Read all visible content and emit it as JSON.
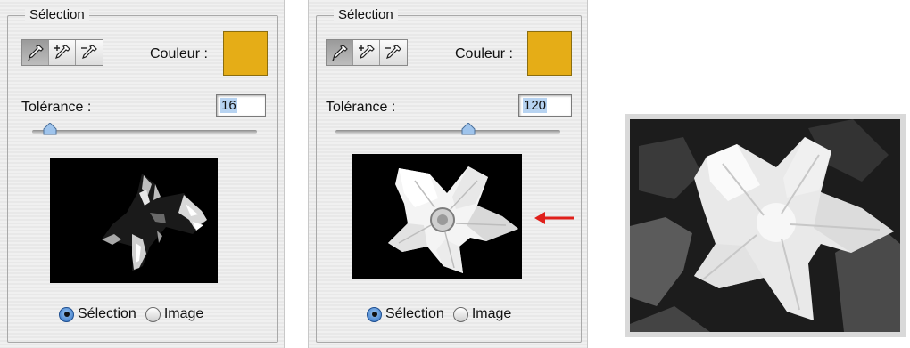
{
  "panels": [
    {
      "group_title": "Sélection",
      "color_label": "Couleur :",
      "color_value": "#e5ad17",
      "tolerance_label": "Tolérance :",
      "tolerance_value": "16",
      "radio_selection": "Sélection",
      "radio_image": "Image",
      "selected_radio": "Sélection",
      "active_tool": "eyedropper"
    },
    {
      "group_title": "Sélection",
      "color_label": "Couleur :",
      "color_value": "#e5ad17",
      "tolerance_label": "Tolérance :",
      "tolerance_value": "120",
      "radio_selection": "Sélection",
      "radio_image": "Image",
      "selected_radio": "Sélection",
      "active_tool": "eyedropper"
    }
  ],
  "arrow_color": "#e0201b",
  "icons": [
    "eyedropper-icon",
    "eyedropper-add-icon",
    "eyedropper-subtract-icon",
    "red-arrow-icon"
  ]
}
